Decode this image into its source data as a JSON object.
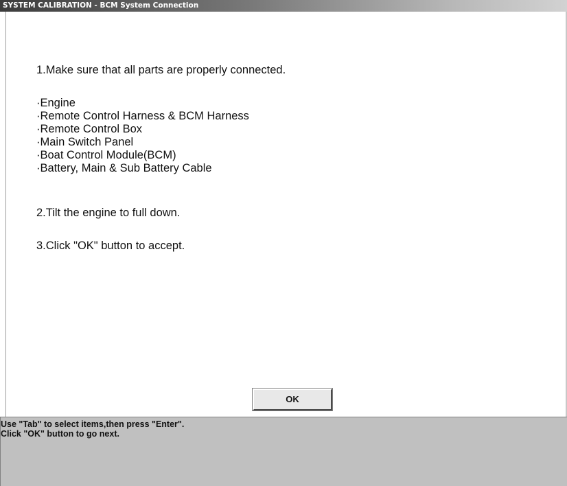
{
  "window": {
    "title": "SYSTEM CALIBRATION - BCM System Connection"
  },
  "instructions": {
    "step1": "1.Make sure that all parts are properly connected.",
    "parts": [
      "·Engine",
      "·Remote Control Harness & BCM Harness",
      "·Remote Control Box",
      "·Main Switch Panel",
      "·Boat Control Module(BCM)",
      "·Battery, Main & Sub Battery Cable"
    ],
    "step2": "2.Tilt the engine to full down.",
    "step3": "3.Click \"OK\" button to accept."
  },
  "buttons": {
    "ok_label": "OK"
  },
  "status": {
    "line1": "Use \"Tab\" to select items,then press \"Enter\".",
    "line2": "Click \"OK\" button to go next."
  }
}
